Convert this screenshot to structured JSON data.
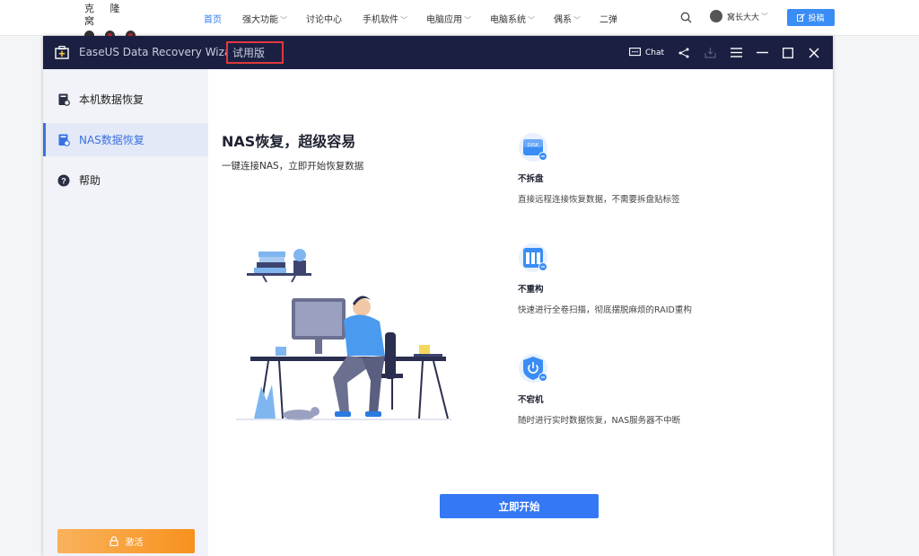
{
  "site": {
    "logo_text": "克 隆 窝",
    "nav": [
      {
        "label": "首页",
        "caret": ""
      },
      {
        "label": "强大功能",
        "caret": "﹀"
      },
      {
        "label": "讨论中心",
        "caret": ""
      },
      {
        "label": "手机软件",
        "caret": "﹀"
      },
      {
        "label": "电脑应用",
        "caret": "﹀"
      },
      {
        "label": "电脑系统",
        "caret": "﹀"
      },
      {
        "label": "偶系",
        "caret": "﹀"
      },
      {
        "label": "二弹",
        "caret": ""
      }
    ],
    "user_name": "窝长大大",
    "user_caret": "﹀",
    "post_label": "投稿"
  },
  "app": {
    "title": "EaseUS Data Recovery Wizard",
    "trial": "试用版",
    "chat_label": "Chat"
  },
  "sidebar": {
    "items": [
      {
        "label": "本机数据恢复"
      },
      {
        "label": "NAS数据恢复"
      },
      {
        "label": "帮助"
      }
    ],
    "activate_label": "激活"
  },
  "main": {
    "title": "NAS恢复，超级容易",
    "subtitle": "一键连接NAS，立即开始恢复数据",
    "features": [
      {
        "title": "不拆盘",
        "desc": "直接远程连接恢复数据，不需要拆盘贴标签",
        "icon": "disk-icon",
        "icon_text": "DISK"
      },
      {
        "title": "不重构",
        "desc": "快速进行全卷扫描，彻底摆脱麻烦的RAID重构",
        "icon": "raid-icon"
      },
      {
        "title": "不宕机",
        "desc": "随时进行实时数据恢复，NAS服务器不中断",
        "icon": "power-icon"
      }
    ],
    "start_label": "立即开始"
  },
  "colors": {
    "titlebar": "#1b2042",
    "accent": "#3478f6",
    "activate": "#f7921e",
    "trial_border": "#e0393e"
  }
}
